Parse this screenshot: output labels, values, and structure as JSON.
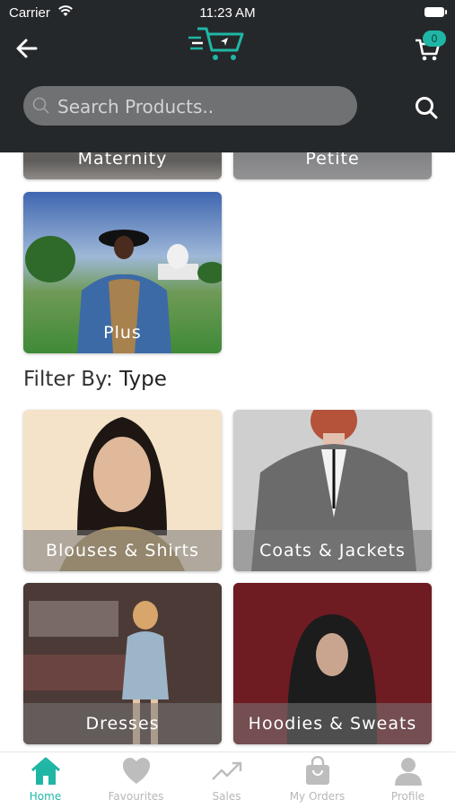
{
  "status_bar": {
    "carrier": "Carrier",
    "time": "11:23 AM"
  },
  "header": {
    "cart_count": "0"
  },
  "search": {
    "placeholder": "Search Products.."
  },
  "categories_top": [
    {
      "label": "Maternity"
    },
    {
      "label": "Petite"
    },
    {
      "label": "Plus"
    }
  ],
  "filter": {
    "prefix": "Filter By:",
    "value": "Type"
  },
  "types": [
    {
      "label": "Blouses & Shirts"
    },
    {
      "label": "Coats & Jackets"
    },
    {
      "label": "Dresses"
    },
    {
      "label": "Hoodies & Sweats"
    }
  ],
  "tabs": [
    {
      "label": "Home",
      "icon": "home-icon",
      "active": true
    },
    {
      "label": "Favourites",
      "icon": "heart-icon",
      "active": false
    },
    {
      "label": "Sales",
      "icon": "trend-icon",
      "active": false
    },
    {
      "label": "My Orders",
      "icon": "bag-icon",
      "active": false
    },
    {
      "label": "Profile",
      "icon": "user-icon",
      "active": false
    }
  ],
  "colors": {
    "accent": "#1fb6a6",
    "header_bg": "#25282a",
    "search_bg": "#6f7173",
    "inactive_tab": "#b7b7b7"
  }
}
